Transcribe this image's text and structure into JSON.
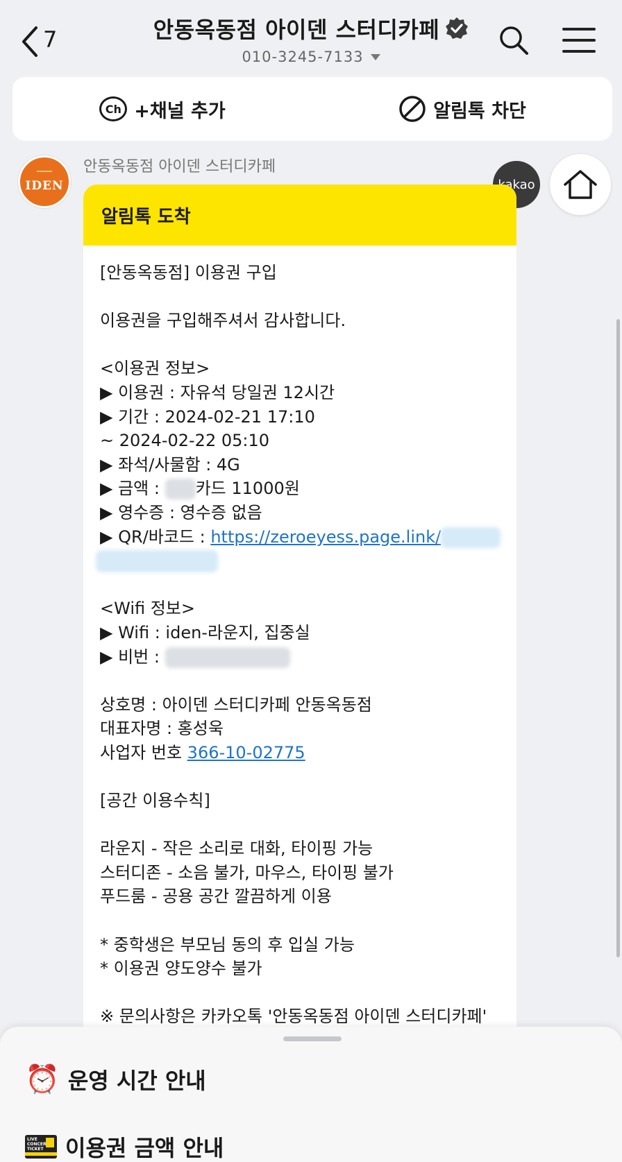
{
  "header": {
    "unread_count": "7",
    "title": "안동옥동점 아이덴 스터디카페",
    "phone": "010-3245-7133"
  },
  "actions": {
    "add_channel": "+채널 추가",
    "block_alimtalk": "알림톡 차단"
  },
  "chat": {
    "sender_name": "안동옥동점 아이덴 스터디카페",
    "avatar_text": "IDEN",
    "kakao_label": "kakao",
    "bubble_title": "알림톡 도착",
    "lines": {
      "l1": "[안동옥동점] 이용권 구입",
      "l2": "이용권을 구입해주셔서 감사합니다.",
      "l3": "<이용권 정보>",
      "l4": "▶ 이용권 : 자유석 당일권 12시간",
      "l5": "▶ 기간 : 2024-02-21 17:10",
      "l6": "~ 2024-02-22 05:10",
      "l7": "▶ 좌석/사물함 : 4G",
      "l8a": "▶ 금액 : ",
      "l8b": "카드 11000원",
      "l9": "▶ 영수증 : 영수증 없음",
      "l10a": "▶ QR/바코드 : ",
      "l10b": "https://zeroeyess.page.link/",
      "l11": "<Wifi 정보>",
      "l12": "▶ Wifi : iden-라운지, 집중실",
      "l13": "▶ 비번 : ",
      "l14": "상호명 : 아이덴 스터디카페 안동옥동점",
      "l15": "대표자명 : 홍성욱",
      "l16a": "사업자 번호 ",
      "l16b": "366-10-02775",
      "l17": "[공간 이용수칙]",
      "l18": "라운지 - 작은 소리로 대화, 타이핑 가능",
      "l19": "스터디존 - 소음 불가, 마우스, 타이핑 불가",
      "l20": "푸드룸 - 공용 공간 깔끔하게 이용",
      "l21": "* 중학생은 부모님 동의 후 입실 가능",
      "l22": "* 이용권 양도양수 불가",
      "l23": "※ 문의사항은 카카오톡 '안동옥동점 아이덴 스터디카페'"
    }
  },
  "sheet": {
    "item1_icon": "⏰",
    "item1_label": "운영 시간 안내",
    "item2_label": "이용권 금액 안내",
    "ticket_text": "LIVE CONCERT TICKET"
  },
  "colors": {
    "accent_yellow": "#fee500",
    "link_blue": "#1d74c9",
    "brand_orange": "#e8701c",
    "background": "#eef0f3"
  },
  "icons": {
    "back": "chevron-left-icon",
    "verified": "verified-check-icon",
    "search": "search-icon",
    "menu": "hamburger-menu-icon",
    "channel": "channel-add-icon",
    "block": "block-icon",
    "home": "home-icon",
    "alarm": "alarm-clock-icon",
    "ticket": "ticket-icon"
  }
}
